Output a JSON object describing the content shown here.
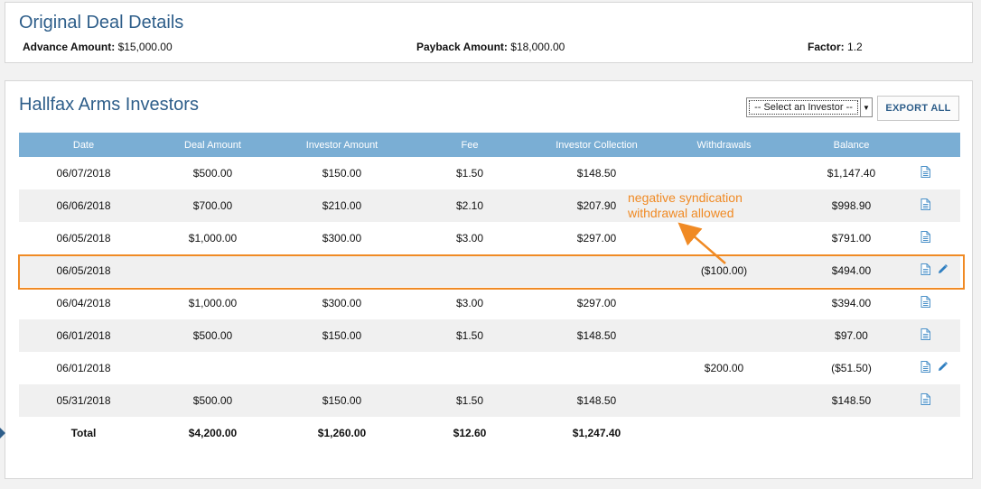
{
  "deal": {
    "title": "Original Deal Details",
    "advance_label": "Advance Amount:",
    "advance_value": "$15,000.00",
    "payback_label": "Payback Amount:",
    "payback_value": "$18,000.00",
    "factor_label": "Factor:",
    "factor_value": "1.2"
  },
  "investors": {
    "title": "Hallfax Arms Investors",
    "select_placeholder": "-- Select an Investor --",
    "export_label": "EXPORT ALL",
    "columns": [
      "Date",
      "Deal Amount",
      "Investor Amount",
      "Fee",
      "Investor Collection",
      "Withdrawals",
      "Balance",
      ""
    ],
    "rows": [
      {
        "date": "06/07/2018",
        "deal": "$500.00",
        "investor": "$150.00",
        "fee": "$1.50",
        "collection": "$148.50",
        "withdrawal": "",
        "balance": "$1,147.40",
        "editable": false
      },
      {
        "date": "06/06/2018",
        "deal": "$700.00",
        "investor": "$210.00",
        "fee": "$2.10",
        "collection": "$207.90",
        "withdrawal": "",
        "balance": "$998.90",
        "editable": false
      },
      {
        "date": "06/05/2018",
        "deal": "$1,000.00",
        "investor": "$300.00",
        "fee": "$3.00",
        "collection": "$297.00",
        "withdrawal": "",
        "balance": "$791.00",
        "editable": false
      },
      {
        "date": "06/05/2018",
        "deal": "",
        "investor": "",
        "fee": "",
        "collection": "",
        "withdrawal": "($100.00)",
        "balance": "$494.00",
        "editable": true
      },
      {
        "date": "06/04/2018",
        "deal": "$1,000.00",
        "investor": "$300.00",
        "fee": "$3.00",
        "collection": "$297.00",
        "withdrawal": "",
        "balance": "$394.00",
        "editable": false
      },
      {
        "date": "06/01/2018",
        "deal": "$500.00",
        "investor": "$150.00",
        "fee": "$1.50",
        "collection": "$148.50",
        "withdrawal": "",
        "balance": "$97.00",
        "editable": false
      },
      {
        "date": "06/01/2018",
        "deal": "",
        "investor": "",
        "fee": "",
        "collection": "",
        "withdrawal": "$200.00",
        "balance": "($51.50)",
        "editable": true
      },
      {
        "date": "05/31/2018",
        "deal": "$500.00",
        "investor": "$150.00",
        "fee": "$1.50",
        "collection": "$148.50",
        "withdrawal": "",
        "balance": "$148.50",
        "editable": false
      }
    ],
    "total": {
      "label": "Total",
      "deal": "$4,200.00",
      "investor": "$1,260.00",
      "fee": "$12.60",
      "collection": "$1,247.40"
    }
  },
  "annotation": {
    "line1": "negative syndication",
    "line2": "withdrawal allowed",
    "color": "#f08a24"
  },
  "icons": {
    "row_view": "document-icon",
    "row_edit": "pencil-icon"
  },
  "colors": {
    "header_blue": "#7aaed4",
    "title_blue": "#2e5e8a",
    "icon_blue": "#4a90c8"
  }
}
